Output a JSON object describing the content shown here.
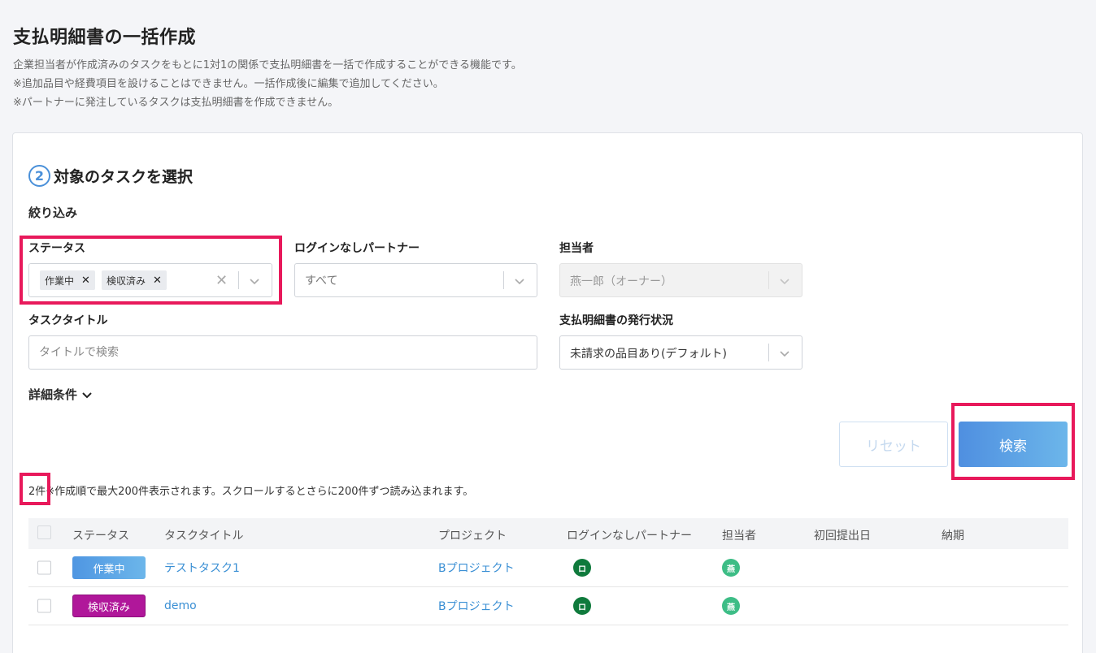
{
  "page": {
    "title": "支払明細書の一括作成",
    "desc1": "企業担当者が作成済みのタスクをもとに1対1の関係で支払明細書を一括で作成することができる機能です。",
    "desc2": "※追加品目や経費項目を設けることはできません。一括作成後に編集で追加してください。",
    "desc3": "※パートナーに発注しているタスクは支払明細書を作成できません。"
  },
  "step": {
    "number": "2",
    "title": "対象のタスクを選択"
  },
  "filter": {
    "title": "絞り込み",
    "status_label": "ステータス",
    "status_chips": [
      "作業中",
      "検収済み"
    ],
    "partner_label": "ログインなしパートナー",
    "partner_placeholder": "すべて",
    "assignee_label": "担当者",
    "assignee_value": "燕一郎（オーナー）",
    "task_title_label": "タスクタイトル",
    "task_title_placeholder": "タイトルで検索",
    "issue_status_label": "支払明細書の発行状況",
    "issue_status_value": "未請求の品目あり(デフォルト)",
    "detail_label": "詳細条件"
  },
  "buttons": {
    "reset": "リセット",
    "search": "検索"
  },
  "results": {
    "count": "2件",
    "note": "※作成順で最大200件表示されます。スクロールするとさらに200件ずつ読み込まれます。"
  },
  "table": {
    "headers": [
      "ステータス",
      "タスクタイトル",
      "プロジェクト",
      "ログインなしパートナー",
      "担当者",
      "初回提出日",
      "納期"
    ],
    "rows": [
      {
        "status": "作業中",
        "status_color": "#5aa4e6",
        "title": "テストタスク1",
        "project": "Bプロジェクト",
        "partner_avatar": "ロ",
        "partner_color": "#0f7a3c",
        "assignee_avatar": "燕",
        "assignee_color": "#3dbd86",
        "first_submit": "",
        "due": ""
      },
      {
        "status": "検収済み",
        "status_color": "#b0179a",
        "title": "demo",
        "project": "Bプロジェクト",
        "partner_avatar": "ロ",
        "partner_color": "#0f7a3c",
        "assignee_avatar": "燕",
        "assignee_color": "#3dbd86",
        "first_submit": "",
        "due": ""
      }
    ]
  },
  "colors": {
    "accent": "#4a90d9",
    "highlight": "#e8195b",
    "link": "#3a8fd4"
  }
}
